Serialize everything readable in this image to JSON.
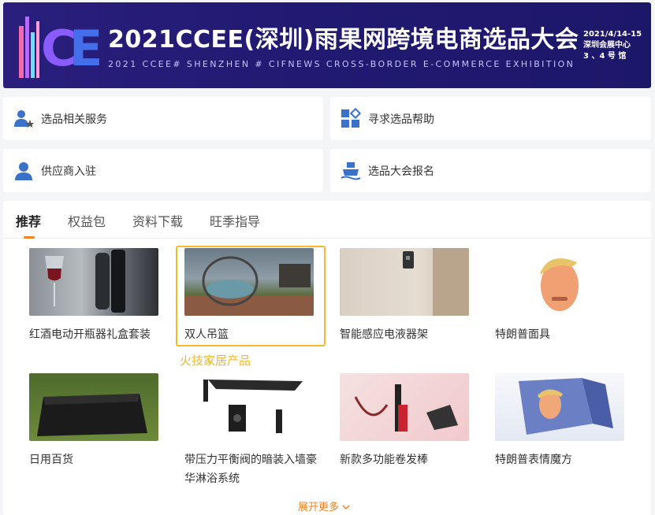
{
  "banner": {
    "title": "2021CCEE(深圳)雨果网跨境电商选品大会",
    "subtitle": "2021 CCEE# SHENZHEN # CIFNEWS CROSS-BORDER E-COMMERCE EXHIBITION",
    "date": "2021/4/14-15",
    "venue": "深圳会展中心",
    "hall": "3 、4 号 馆",
    "brand_color": "#221a73"
  },
  "services": [
    {
      "label": "选品相关服务",
      "icon": "people-star-icon"
    },
    {
      "label": "寻求选品帮助",
      "icon": "grid-diamond-icon"
    },
    {
      "label": "供应商入驻",
      "icon": "person-icon"
    },
    {
      "label": "选品大会报名",
      "icon": "ship-icon"
    }
  ],
  "tabs": [
    {
      "label": "推荐",
      "active": true
    },
    {
      "label": "权益包",
      "active": false
    },
    {
      "label": "资料下载",
      "active": false
    },
    {
      "label": "旺季指导",
      "active": false
    }
  ],
  "products": [
    {
      "name": "红酒电动开瓶器礼盒套装"
    },
    {
      "name": "双人吊篮"
    },
    {
      "name": "智能感应电液器架"
    },
    {
      "name": "特朗普面具"
    },
    {
      "name": "日用百货"
    },
    {
      "name": "带压力平衡阀的暗装入墙豪华淋浴系统"
    },
    {
      "name": "新款多功能卷发棒"
    },
    {
      "name": "特朗普表情魔方"
    }
  ],
  "annotation": "火技家居产品",
  "more_label": "展开更多",
  "accent_color": "#f5811f"
}
